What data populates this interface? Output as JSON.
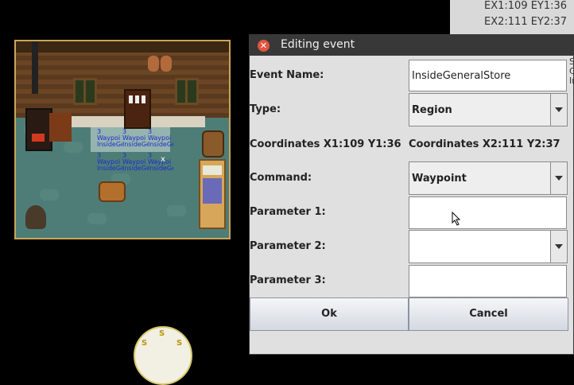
{
  "status": {
    "ex1": "EX1:109 EY1:36",
    "ex2": "EX2:111 EY2:37"
  },
  "map": {
    "waypoints": [
      {
        "num": "3",
        "label": "Waypoi"
      },
      {
        "num": "3",
        "label": "Waypoi"
      },
      {
        "num": "3",
        "label": "Waypoi"
      },
      {
        "num": "3",
        "label": "Waypoi"
      },
      {
        "num": "3",
        "label": "Waypoi"
      },
      {
        "num": "3",
        "label": "Waypoi"
      }
    ],
    "waypoint_sub": "InsideGe",
    "cursor_mark": "x",
    "wheel_letters": [
      "S",
      "S",
      "S"
    ]
  },
  "dialog": {
    "title": "Editing event",
    "close_icon": "close-icon",
    "event_name_label": "Event Name:",
    "event_name_value": "InsideGeneralStore",
    "type_label": "Type:",
    "type_value": "Region",
    "coords1": "Coordinates X1:109 Y1:36",
    "coords2": "Coordinates X2:111 Y2:37",
    "command_label": "Command:",
    "command_value": "Waypoint",
    "param1_label": "Parameter 1:",
    "param1_value": "",
    "param2_label": "Parameter 2:",
    "param2_value": "",
    "param3_label": "Parameter 3:",
    "param3_value": "",
    "ok_label": "Ok",
    "cancel_label": "Cancel"
  },
  "edge_text": [
    "S",
    "C",
    "Ir"
  ],
  "colors": {
    "titlebar": "#383838",
    "close": "#e2553e",
    "waypoint_text": "#1a2ecc"
  }
}
